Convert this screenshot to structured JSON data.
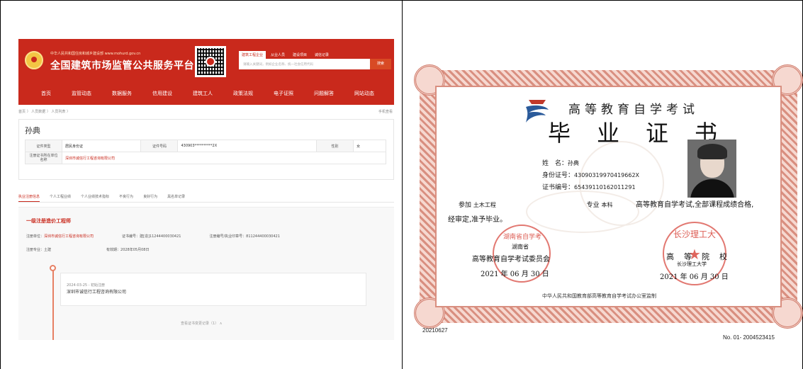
{
  "left_panel": {
    "site": {
      "ministry_line": "中华人民共和国住房和城乡建设部 www.mohurd.gov.cn",
      "title": "全国建筑市场监管公共服务平台",
      "search_tabs": [
        "建筑工程企业",
        "从业人员",
        "建设项目",
        "诚信记录"
      ],
      "search_placeholder": "请输入关键词，例如企业名称、统一社会信用代码",
      "search_button": "搜索",
      "nav": [
        "首页",
        "监管动态",
        "数据服务",
        "信用建设",
        "建筑工人",
        "政策法规",
        "电子证照",
        "问题解答",
        "网站动态"
      ],
      "breadcrumb": "首页 〉 人员数据 〉 人员列表 〉",
      "mobile_view": "手机查看",
      "person": {
        "name": "孙典",
        "id_type_label": "证件类型",
        "id_type_value": "居民身份证",
        "id_no_label": "证件号码",
        "id_no_value": "430903**********2X",
        "gender_label": "性别",
        "gender_value": "女",
        "unit_label": "注册证书所在单位名称",
        "unit_value": "深圳市诚信行工程咨询有限公司"
      },
      "sub_tabs": [
        "执业注册信息",
        "个人工程业绩",
        "个人业绩技术指标",
        "不良行为",
        "良好行为",
        "黑名单记录"
      ],
      "registration": {
        "title": "一级注册造价工程师",
        "unit_label": "注册单位：",
        "unit_value": "深圳市诚信行工程咨询有限公司",
        "cert_no_text": "证书编号：建[造]11244400030421",
        "reg_no_text": "注册编号/执业印章号：811244400030421",
        "major_text": "注册专业：土建",
        "valid_text": "有效期：2028年05月08日"
      },
      "timeline": {
        "date_text": "2024-03-25 - 初始注册",
        "company": "深圳市诚信行工程咨询有限公司"
      },
      "view_more": "查看证书变更记录（1） ∧"
    }
  },
  "right_panel": {
    "certificate": {
      "top_title": "高等教育自学考试",
      "main_title": "毕业证书",
      "name_label": "姓　名：",
      "name_value": "孙典",
      "id_label": "身份证号：",
      "id_value": "430903199704196​62X",
      "cert_no_label": "证书编号：",
      "cert_no_value": "65439110162011291",
      "line1_prefix": "参加",
      "line1_major": "土木工程",
      "line1_mid": "专业",
      "line1_level": "本科",
      "line1_tail": "高等教育自学考试,全部课程成绩合格,",
      "line2": "经审定,准予毕业。",
      "left_seal_text": "湖南省自学考",
      "left_province": "湖南省",
      "left_issuer": "高等教育自学考试委员会",
      "left_date": "2021 年 06 月 30 日",
      "right_seal_text": "长沙理工大",
      "right_issuer": "高等院校",
      "right_issuer_sub": "长沙理工大学",
      "right_date": "2021 年 06 月 30 日",
      "supervise": "中华人民共和国教育部高等教育自学考试办公室监制"
    },
    "serial_left": "20210627",
    "serial_right": "No. 01- 2004523415"
  }
}
